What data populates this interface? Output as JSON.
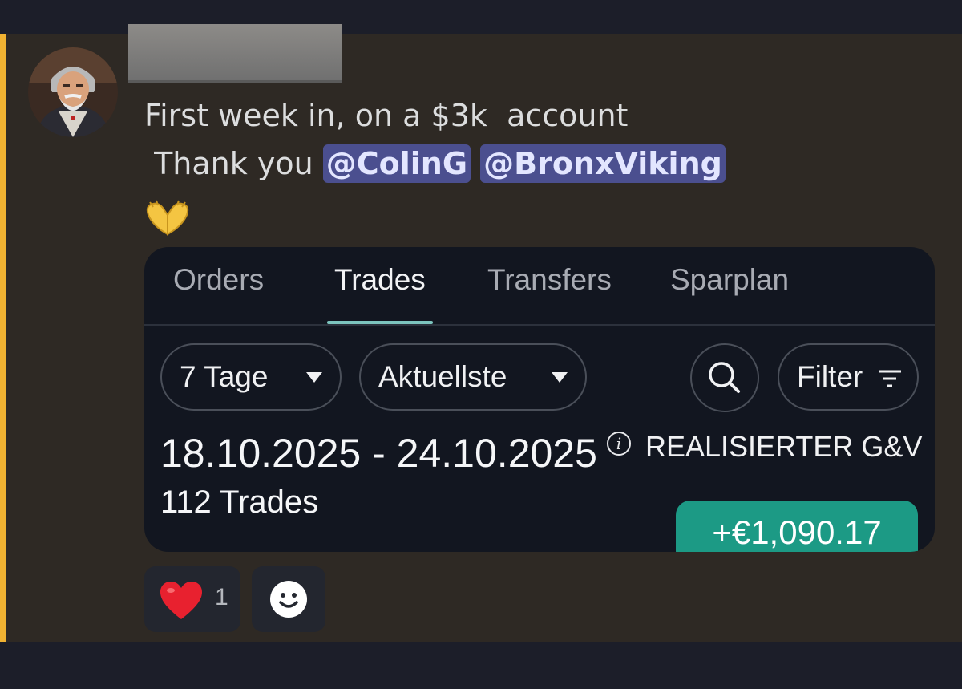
{
  "message": {
    "line1": "First week in, on a $3k  account",
    "line2_prefix": " Thank you ",
    "mentions": [
      "@ColinG",
      "@BronxViking"
    ],
    "emoji": "heart-hands-emoji"
  },
  "tabs": [
    {
      "label": "Orders",
      "active": false
    },
    {
      "label": "Trades",
      "active": true
    },
    {
      "label": "Transfers",
      "active": false
    },
    {
      "label": "Sparplan",
      "active": false
    }
  ],
  "filters": {
    "period": "7 Tage",
    "sort": "Aktuellste",
    "filter_label": "Filter"
  },
  "summary": {
    "date_range": "18.10.2025 - 24.10.2025",
    "trades_count": "112 Trades",
    "pnl_label": "REALISIERTER G&V",
    "pnl_value": "+€1,090.17"
  },
  "reactions": [
    {
      "emoji": "red-heart-emoji",
      "count": "1"
    },
    {
      "emoji": "add-reaction-icon"
    }
  ],
  "colors": {
    "accent_bar": "#f0b232",
    "mention_bg": "#4b4f8f",
    "pnl_bg": "#1c9a85",
    "active_tab_underline": "#7cc4be"
  }
}
